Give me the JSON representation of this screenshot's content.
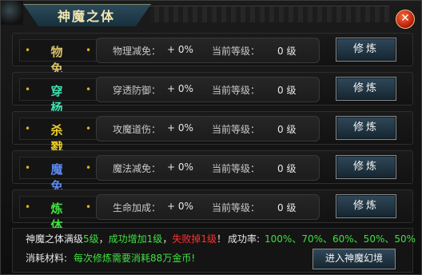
{
  "window": {
    "title": "神魔之体",
    "close_glyph": "✕"
  },
  "rows": [
    {
      "name": "物 免",
      "name_color": "#d9c36a",
      "stat_label": "物理减免：",
      "stat_value": "+ 0%",
      "level_label": "当前等级：",
      "level_value": "0 级",
      "button": "修炼"
    },
    {
      "name": "穿 杨",
      "name_color": "#3fe0b0",
      "stat_label": "穿透防御：",
      "stat_value": "+ 0%",
      "level_label": "当前等级：",
      "level_value": "0 级",
      "button": "修炼"
    },
    {
      "name": "杀 戮",
      "name_color": "#f0d020",
      "stat_label": "攻魔道伤：",
      "stat_value": "+ 0%",
      "level_label": "当前等级：",
      "level_value": "0 级",
      "button": "修炼"
    },
    {
      "name": "魔 免",
      "name_color": "#5a8af0",
      "stat_label": "魔法减免：",
      "stat_value": "+ 0%",
      "level_label": "当前等级：",
      "level_value": "0 级",
      "button": "修炼"
    },
    {
      "name": "炼 体",
      "name_color": "#40e040",
      "stat_label": "生命加成：",
      "stat_value": "+ 0%",
      "level_label": "当前等级：",
      "level_value": "0 级",
      "button": "修炼"
    }
  ],
  "footer": {
    "max_level_prefix": "神魔之体满级",
    "max_level_value": "5级",
    "sep1": "，",
    "success_text": "成功增加1级",
    "sep2": "，",
    "fail_text": "失败掉1级",
    "sep3": "！",
    "rate_label": "成功率:",
    "rates": "100%、70%、60%、50%、50%",
    "material_label": "消耗材料:",
    "material_text": "每次修炼需要消耗88万金币!",
    "enter_button": "进入神魔幻境"
  },
  "colors": {
    "footer_label": "#e8e8e8",
    "footer_green": "#40e040",
    "footer_red": "#ff3030"
  }
}
